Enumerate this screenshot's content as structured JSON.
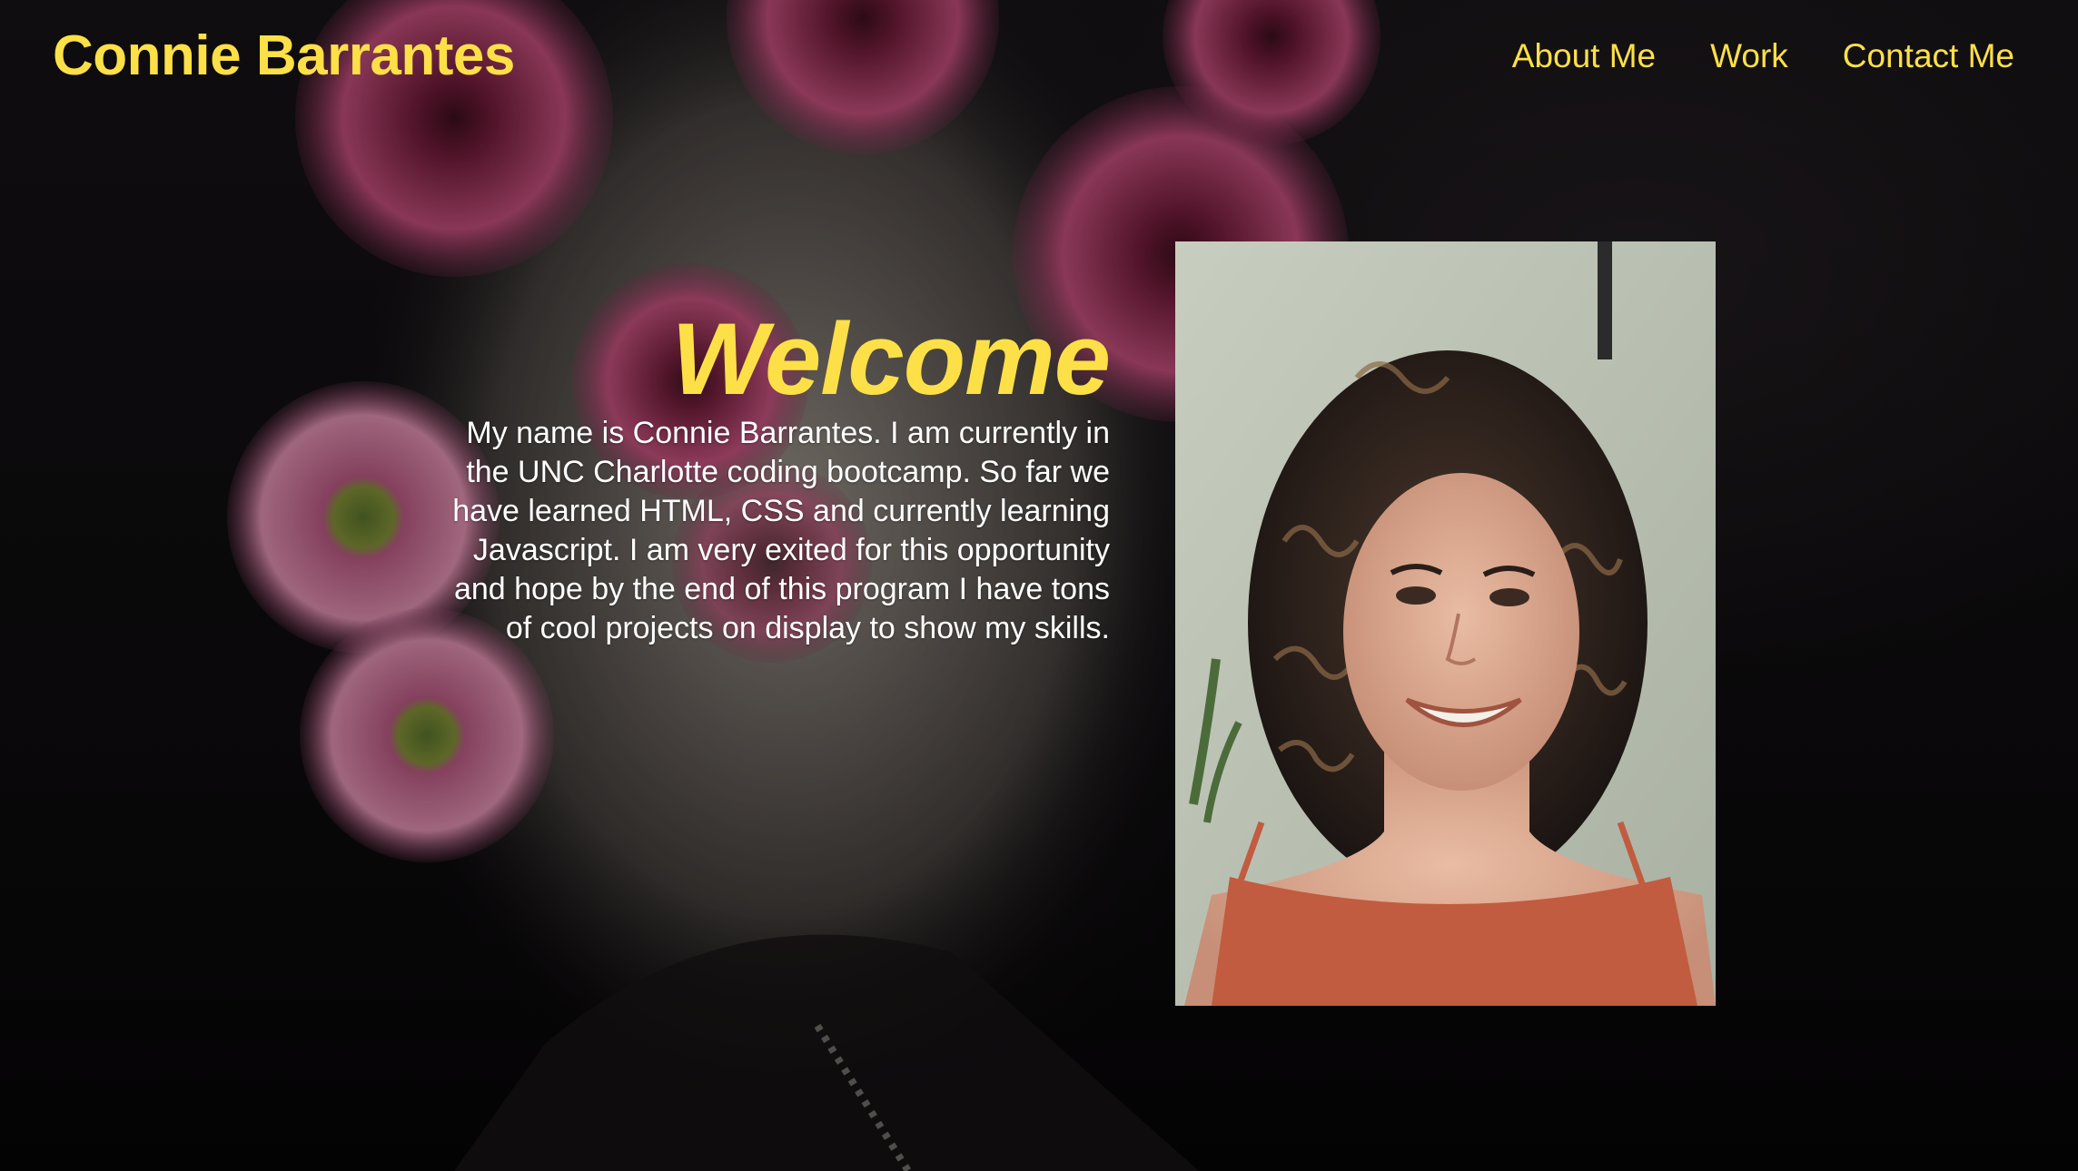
{
  "header": {
    "brand": "Connie Barrantes",
    "nav": [
      "About Me",
      "Work",
      "Contact Me"
    ]
  },
  "hero": {
    "heading": "Welcome",
    "bio": "My name is Connie Barrantes. I am currently in the UNC Charlotte coding bootcamp. So far we have learned HTML, CSS and currently learning Javascript. I am very exited for this opportunity and hope by the end of this program I have tons of cool projects on display to show my skills."
  },
  "colors": {
    "accent": "#fde047",
    "text": "#ffffff",
    "background": "#0b0a0c"
  },
  "images": {
    "background": "flowers-background-photo",
    "portrait": "profile-photo"
  }
}
